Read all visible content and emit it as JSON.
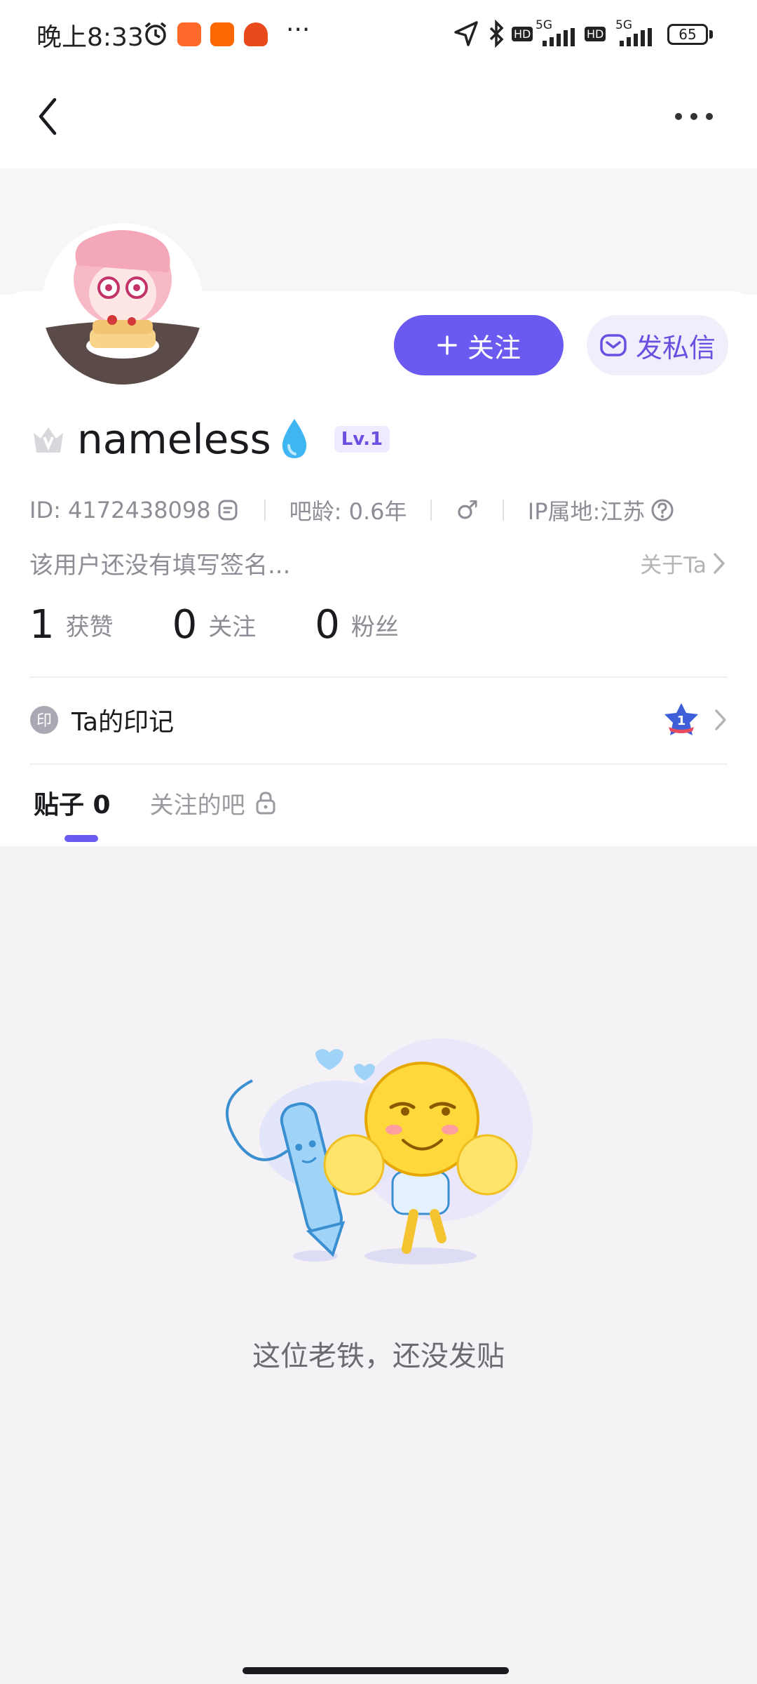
{
  "status_bar": {
    "time": "晚上8:33",
    "more": "···",
    "battery": "65",
    "network_5g_1": "5G",
    "network_5g_2": "5G",
    "hd_1": "HD",
    "hd_2": "HD"
  },
  "nav": {
    "back_icon": "chevron-left-icon",
    "more_icon": "more-horizontal-icon"
  },
  "profile": {
    "username": "nameless",
    "level": "Lv.1",
    "id_text": "ID: 4172438098",
    "bar_age": "吧龄: 0.6年",
    "gender_symbol": "♂",
    "ip_location": "IP属地:江苏",
    "signature": "该用户还没有填写签名...",
    "about_link": "关于Ta"
  },
  "actions": {
    "follow_label": "关注",
    "message_label": "发私信"
  },
  "stats": [
    {
      "value": "1",
      "label": "获赞"
    },
    {
      "value": "0",
      "label": "关注"
    },
    {
      "value": "0",
      "label": "粉丝"
    }
  ],
  "marks": {
    "label": "Ta的印记",
    "badge_value": "1"
  },
  "tabs": [
    {
      "label": "贴子 0",
      "active": true
    },
    {
      "label": "关注的吧",
      "active": false
    }
  ],
  "empty_state": {
    "message": "这位老铁，还没发贴"
  },
  "colors": {
    "accent": "#6a5af0",
    "accent_light": "#f1eefc",
    "empty_bg": "#f5f2f6"
  }
}
